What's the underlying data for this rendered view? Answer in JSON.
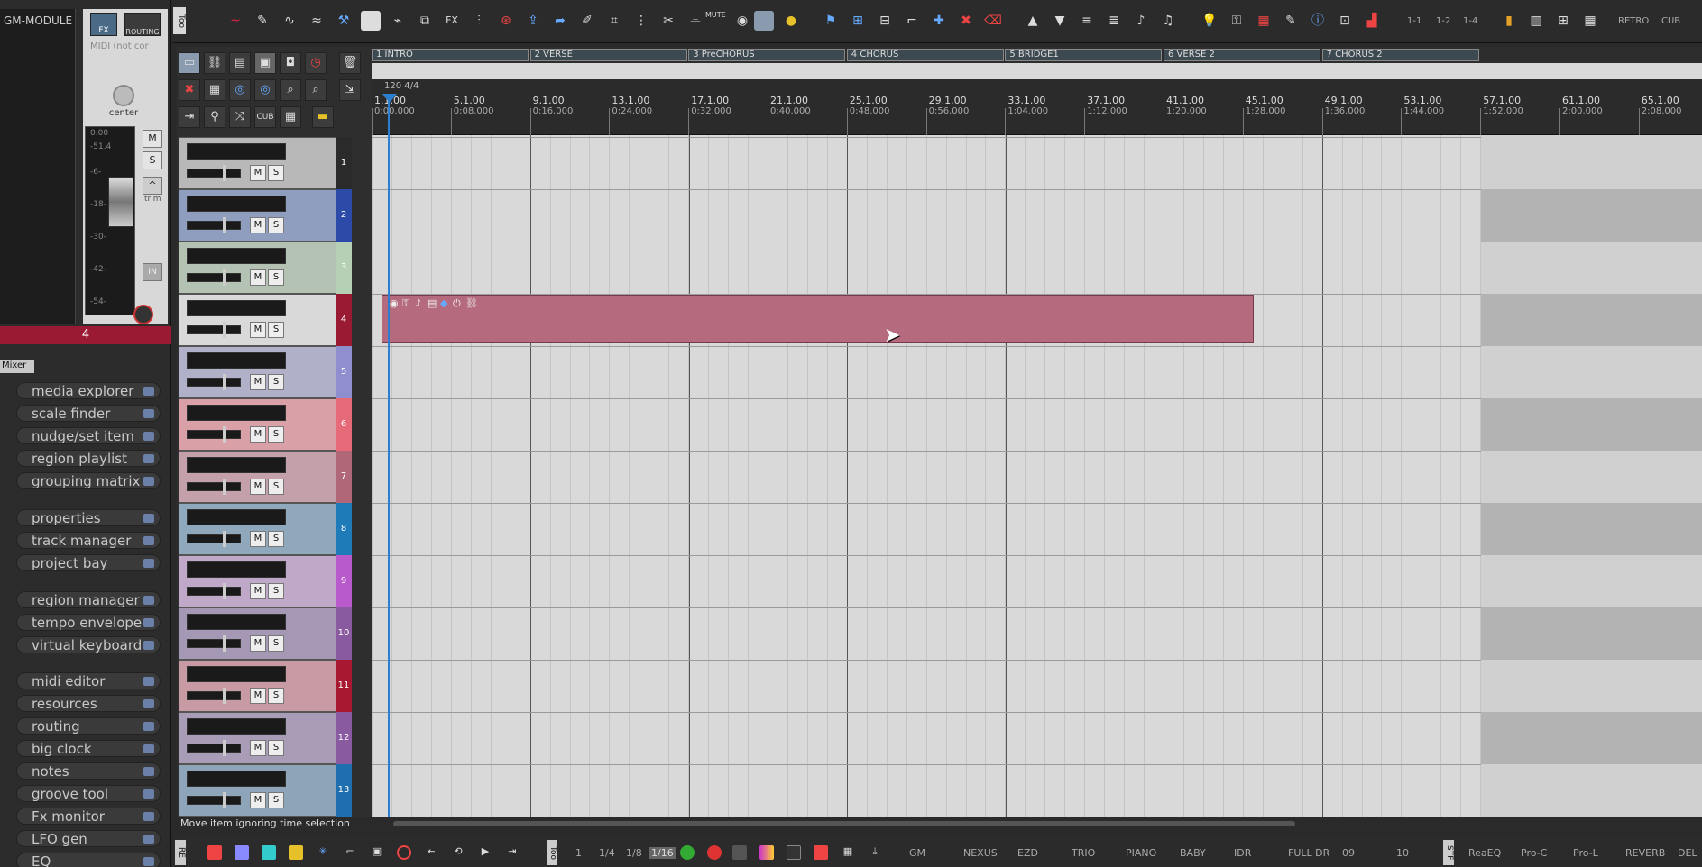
{
  "app": {
    "status_text": "Move item ignoring time selection"
  },
  "gm_module": {
    "title": "GM-MODULE",
    "fx_label": "FX",
    "routing_label": "ROUTING",
    "midi_label": "MIDI (not cor"
  },
  "mixer_strip": {
    "pan_label": "center",
    "volume_readout": "0.00",
    "peak_readout": "-51.4",
    "trim_label": "trim",
    "in_label": "IN",
    "track_number": "4",
    "mute_label": "M",
    "solo_label": "S",
    "scale": [
      "-6-",
      "-18-",
      "-30-",
      "-42-",
      "-54-"
    ]
  },
  "mixer_tab": {
    "label": "Mixer"
  },
  "dock_items": [
    "media explorer",
    "scale finder",
    "nudge/set item",
    "region playlist",
    "grouping matrix",
    "properties",
    "track manager",
    "project bay",
    "region manager",
    "tempo envelope",
    "virtual keyboard",
    "midi editor",
    "resources",
    "routing",
    "big clock",
    "notes",
    "groove tool",
    "Fx monitor",
    "LFO gen",
    "EQ"
  ],
  "toolbar": {
    "side_tag": "Too",
    "mute_label": "MUTE",
    "fx_label": "FX",
    "grid_labels": [
      "1-1",
      "1-2",
      "1-4"
    ],
    "retro_label": "RETRO",
    "cub_label": "CUB"
  },
  "tcp_tools": {
    "cub_label": "CUB"
  },
  "tracks": [
    {
      "num": "1",
      "color": "#b8b8b8",
      "num_color": "#2a2a2a"
    },
    {
      "num": "2",
      "color": "#8f9dbf",
      "num_color": "#2c4aa8"
    },
    {
      "num": "3",
      "color": "#b4c2b4",
      "num_color": "#b6d0b6"
    },
    {
      "num": "4",
      "color": "#d9d9d9",
      "num_color": "#9b1a33"
    },
    {
      "num": "5",
      "color": "#b0b0c8",
      "num_color": "#8f8fd0"
    },
    {
      "num": "6",
      "color": "#d9a0a8",
      "num_color": "#e66a78"
    },
    {
      "num": "7",
      "color": "#c4a0aa",
      "num_color": "#b06878"
    },
    {
      "num": "8",
      "color": "#8fa8bc",
      "num_color": "#1f7ab8"
    },
    {
      "num": "9",
      "color": "#c0a8c8",
      "num_color": "#b85acb"
    },
    {
      "num": "10",
      "color": "#a498b4",
      "num_color": "#8a5aa0"
    },
    {
      "num": "11",
      "color": "#c89aa4",
      "num_color": "#a81830"
    },
    {
      "num": "12",
      "color": "#a89cb6",
      "num_color": "#8a5aa0"
    },
    {
      "num": "13",
      "color": "#8ea4b8",
      "num_color": "#1f6fb0"
    }
  ],
  "regions": [
    "1  INTRO",
    "2  VERSE",
    "3  PreCHORUS",
    "4  CHORUS",
    "5  BRIDGE1",
    "6  VERSE 2",
    "7  CHORUS 2"
  ],
  "tempo_marker": "120 4/4",
  "ruler": [
    {
      "bar": "1.1.00",
      "time": "0:00.000"
    },
    {
      "bar": "5.1.00",
      "time": "0:08.000"
    },
    {
      "bar": "9.1.00",
      "time": "0:16.000"
    },
    {
      "bar": "13.1.00",
      "time": "0:24.000"
    },
    {
      "bar": "17.1.00",
      "time": "0:32.000"
    },
    {
      "bar": "21.1.00",
      "time": "0:40.000"
    },
    {
      "bar": "25.1.00",
      "time": "0:48.000"
    },
    {
      "bar": "29.1.00",
      "time": "0:56.000"
    },
    {
      "bar": "33.1.00",
      "time": "1:04.000"
    },
    {
      "bar": "37.1.00",
      "time": "1:12.000"
    },
    {
      "bar": "41.1.00",
      "time": "1:20.000"
    },
    {
      "bar": "45.1.00",
      "time": "1:28.000"
    },
    {
      "bar": "49.1.00",
      "time": "1:36.000"
    },
    {
      "bar": "53.1.00",
      "time": "1:44.000"
    },
    {
      "bar": "57.1.00",
      "time": "1:52.000"
    },
    {
      "bar": "61.1.00",
      "time": "2:00.000"
    },
    {
      "bar": "65.1.00",
      "time": "2:08.000"
    }
  ],
  "bottom_bar": {
    "side_tags": [
      "RE",
      "Too",
      "STF"
    ],
    "grid_values": [
      "1",
      "1/4",
      "1/8",
      "1/16"
    ],
    "instruments": [
      "GM",
      "NEXUS",
      "EZD",
      "TRIO",
      "PIANO",
      "BABY",
      "IDR",
      "FULL DR",
      "09",
      "10"
    ],
    "plugins": [
      "ReaEQ",
      "Pro-C",
      "Pro-L",
      "REVERB",
      "DEL"
    ]
  }
}
